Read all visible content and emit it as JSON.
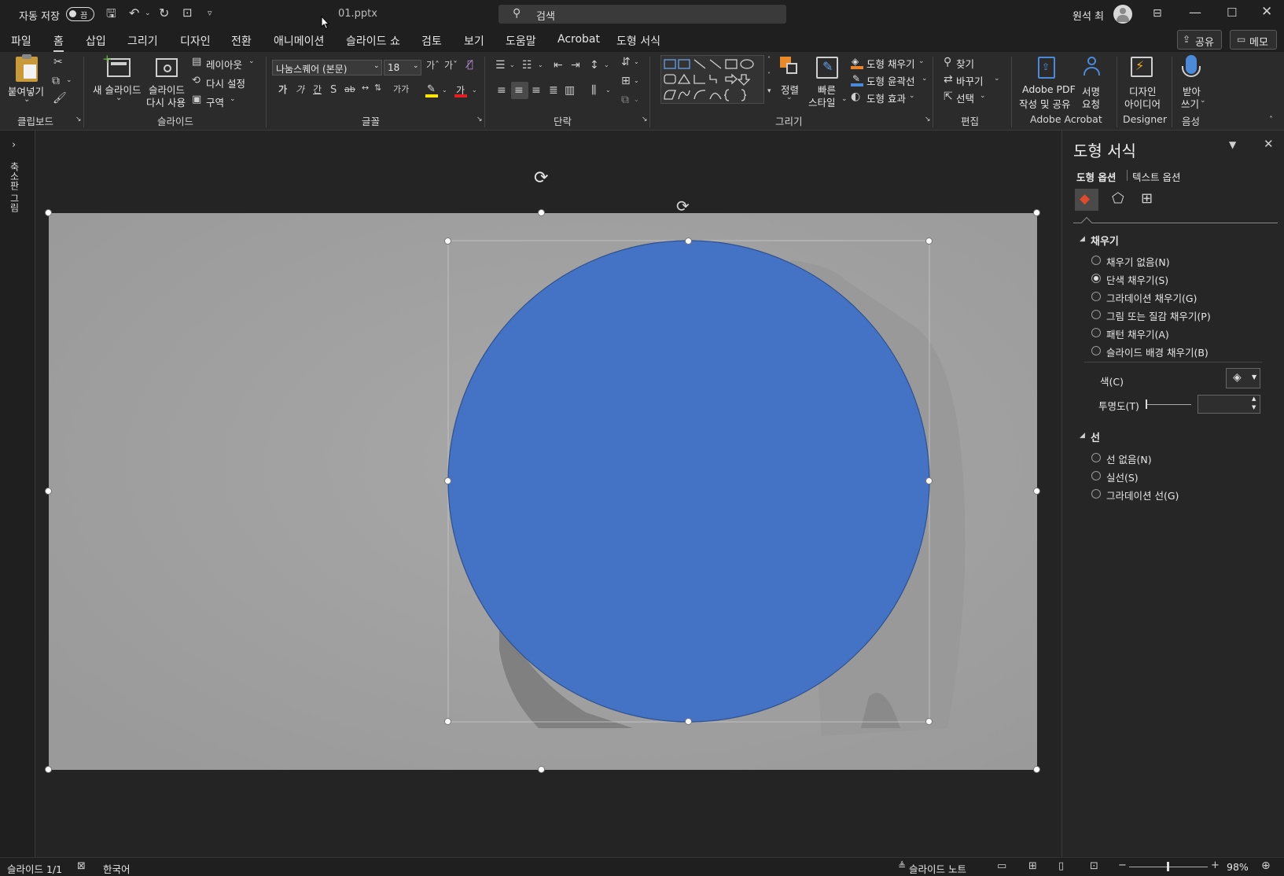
{
  "titlebar": {
    "autosave_label": "자동 저장",
    "autosave_toggle": "끔",
    "filename": "01.pptx",
    "search_placeholder": "검색",
    "user_name": "원석 최"
  },
  "tabs": [
    "파일",
    "홈",
    "삽입",
    "그리기",
    "디자인",
    "전환",
    "애니메이션",
    "슬라이드 쇼",
    "검토",
    "보기",
    "도움말",
    "Acrobat",
    "도형 서식"
  ],
  "share_button": "공유",
  "memo_button": "메모",
  "ribbon": {
    "clipboard": {
      "paste": "붙여넣기",
      "label": "클립보드"
    },
    "slides": {
      "new_slide": "새 슬라이드",
      "reuse_1": "슬라이드",
      "reuse_2": "다시 사용",
      "layout": "레이아웃",
      "reset": "다시 설정",
      "section": "구역",
      "label": "슬라이드"
    },
    "font": {
      "name": "나눔스퀘어 (본문)",
      "size": "18",
      "label": "글꼴"
    },
    "paragraph": {
      "label": "단락"
    },
    "drawing": {
      "arrange": "정렬",
      "quick_1": "빠른",
      "quick_2": "스타일",
      "fill": "도형 채우기",
      "outline": "도형 윤곽선",
      "effect": "도형 효과",
      "label": "그리기"
    },
    "editing": {
      "find": "찾기",
      "replace": "바꾸기",
      "select": "선택",
      "label": "편집"
    },
    "acrobat": {
      "create_1": "Adobe PDF",
      "create_2": "작성 및 공유",
      "sign_1": "서명",
      "sign_2": "요청",
      "label": "Adobe Acrobat"
    },
    "designer": {
      "ideas_1": "디자인",
      "ideas_2": "아이디어",
      "label": "Designer"
    },
    "voice": {
      "dictate_1": "받아",
      "dictate_2": "쓰기",
      "label": "음성"
    }
  },
  "left_strip_label": "축소판 그림",
  "pane": {
    "title": "도형 서식",
    "tab_shape": "도형 옵션",
    "tab_text": "텍스트 옵션",
    "fill_section": "채우기",
    "fill_options": [
      "채우기 없음(N)",
      "단색 채우기(S)",
      "그라데이션 채우기(G)",
      "그림 또는 질감 채우기(P)",
      "패턴 채우기(A)",
      "슬라이드 배경 채우기(B)"
    ],
    "fill_selected_index": 1,
    "color_label": "색(C)",
    "transparency_label": "투명도(T)",
    "line_section": "선",
    "line_options": [
      "선 없음(N)",
      "실선(S)",
      "그라데이션 선(G)"
    ]
  },
  "slide": {
    "circle_color": "#4472c4",
    "background_color": "#a0a0a0"
  },
  "status": {
    "slide_counter": "슬라이드 1/1",
    "language": "한국어",
    "notes": "슬라이드 노트",
    "zoom": "98%"
  }
}
